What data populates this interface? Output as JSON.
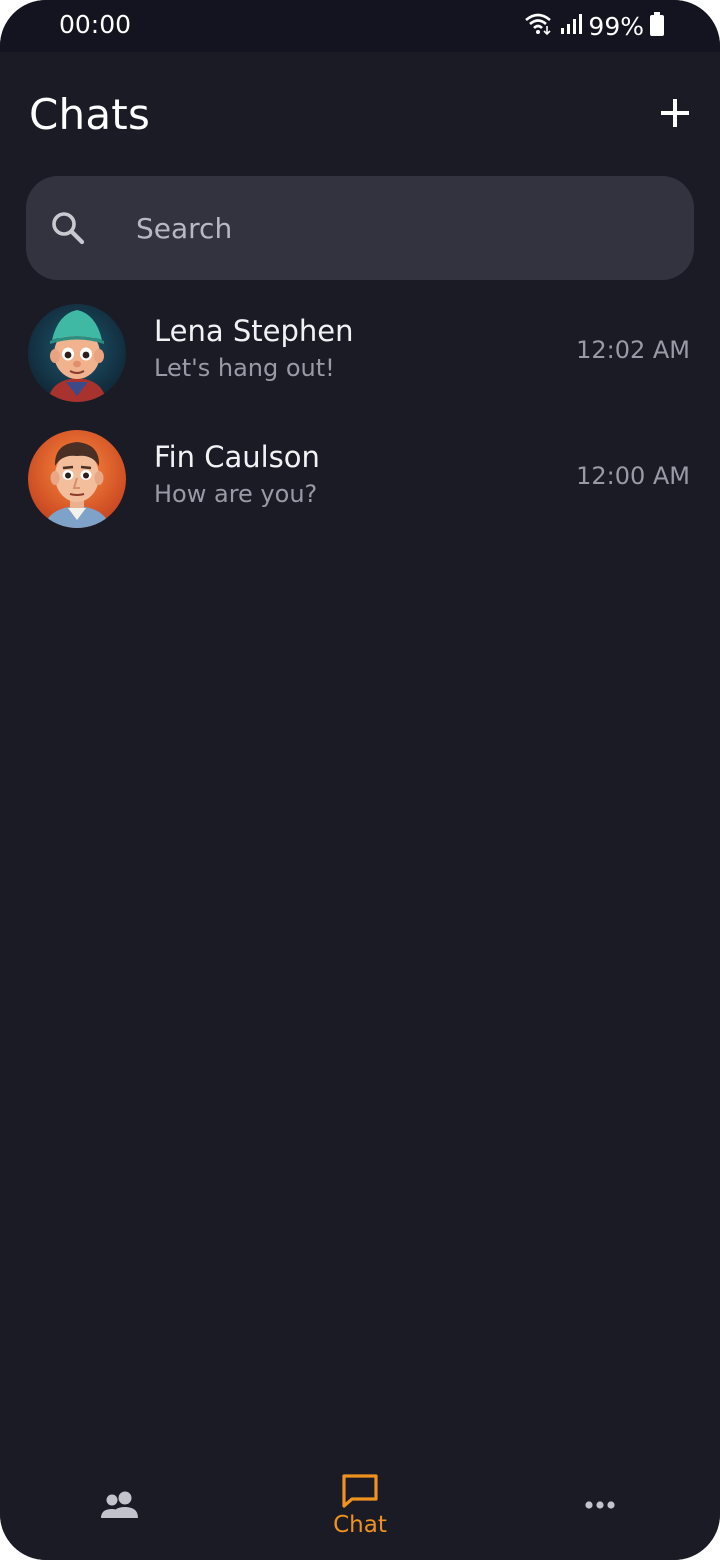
{
  "status_bar": {
    "time": "00:00",
    "battery": "99%",
    "icons": [
      "wifi-icon",
      "signal-icon",
      "battery-icon"
    ]
  },
  "header": {
    "title": "Chats",
    "add_icon": "plus-icon"
  },
  "search": {
    "placeholder": "Search",
    "value": ""
  },
  "chats": [
    {
      "name": "Lena Stephen",
      "preview": "Let's hang out!",
      "time": "12:02 AM",
      "avatar": "cartoon-boy-green-hat-avatar"
    },
    {
      "name": "Fin Caulson",
      "preview": "How are you?",
      "time": "12:00 AM",
      "avatar": "cartoon-man-orange-avatar"
    }
  ],
  "bottom_nav": {
    "items": [
      {
        "icon": "contacts-icon",
        "label": ""
      },
      {
        "icon": "chat-icon",
        "label": "Chat",
        "active": true
      },
      {
        "icon": "more-icon",
        "label": ""
      }
    ]
  },
  "colors": {
    "background": "#1b1b26",
    "status_bar": "#141420",
    "search_bg": "#33333f",
    "accent": "#f0921f",
    "secondary_text": "#9a9aa6"
  }
}
